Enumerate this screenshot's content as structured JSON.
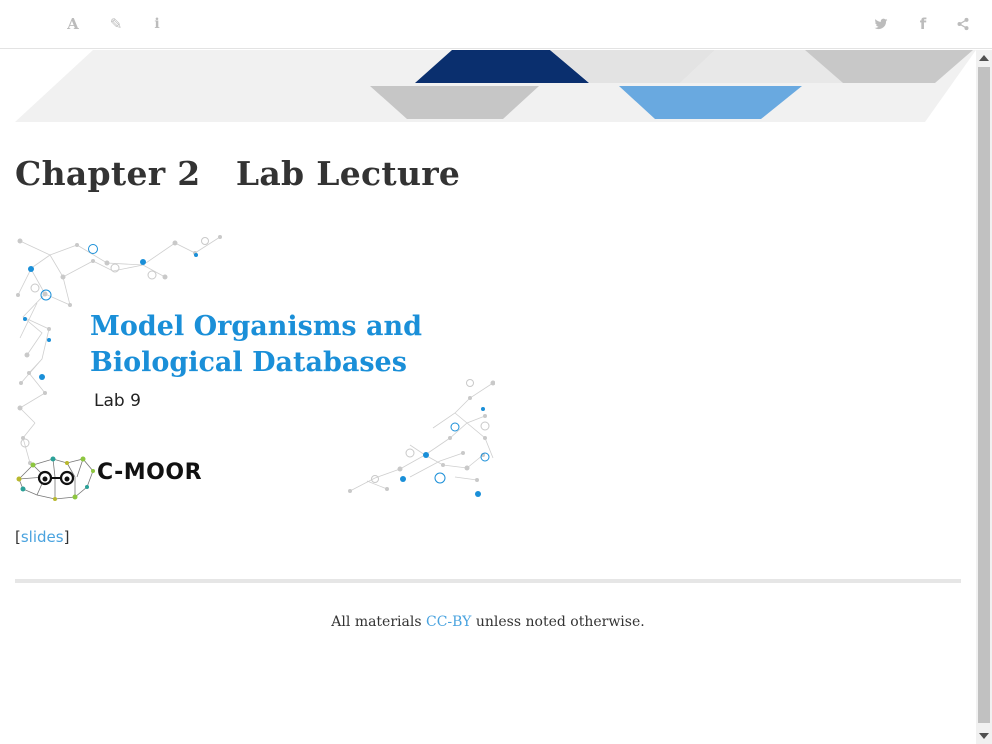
{
  "toolbar": {
    "left_buttons": [
      {
        "icon": "font-icon",
        "glyph": "A"
      },
      {
        "icon": "edit-icon",
        "glyph": "✎"
      },
      {
        "icon": "info-icon",
        "glyph": "i"
      }
    ],
    "right_buttons": [
      {
        "icon": "twitter-icon"
      },
      {
        "icon": "facebook-icon",
        "glyph": "f"
      },
      {
        "icon": "share-icon"
      }
    ]
  },
  "chapter": {
    "number": "Chapter 2",
    "title": "Lab Lecture"
  },
  "slide": {
    "title_line1": "Model Organisms and",
    "title_line2": "Biological Databases",
    "subtitle": "Lab 9",
    "logo_text": "C-MOOR"
  },
  "links": {
    "open_bracket": "[",
    "slides_label": "slides",
    "close_bracket": "]"
  },
  "footer": {
    "prefix": "All materials ",
    "license_link": "CC-BY",
    "suffix": " unless noted otherwise."
  },
  "colors": {
    "accent_blue": "#1a8fd8",
    "link_blue": "#4aa3df",
    "banner_navy": "#0a2f6e",
    "banner_light_blue": "#69a9e0",
    "toolbar_icon": "#bcbcbc"
  }
}
